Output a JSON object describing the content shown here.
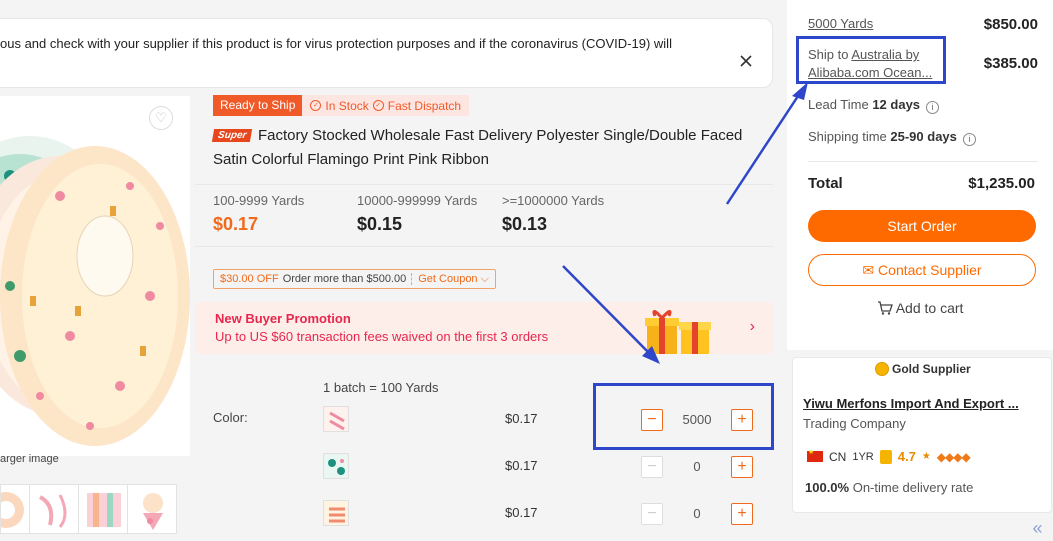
{
  "notice": {
    "text": "ous and check with your supplier if this product is for virus protection purposes and if the coronavirus (COVID-19) will"
  },
  "gallery": {
    "larger_hint": "arger image"
  },
  "product": {
    "badge_ready": "Ready to Ship",
    "badge_in_stock": "In Stock",
    "badge_fast_dispatch": "Fast Dispatch",
    "super_badge": "Super",
    "title": "Factory Stocked Wholesale Fast Delivery Polyester Single/Double Faced Satin Colorful Flamingo Print Pink Ribbon"
  },
  "price_tiers": [
    {
      "range": "100-9999 Yards",
      "price": "$0.17"
    },
    {
      "range": "10000-999999 Yards",
      "price": "$0.15"
    },
    {
      "range": ">=1000000 Yards",
      "price": "$0.13"
    }
  ],
  "coupon": {
    "off": "$30.00 OFF",
    "condition": "Order more than $500.00",
    "get": "Get Coupon"
  },
  "promo": {
    "title": "New Buyer Promotion",
    "subtitle": "Up to US $60 transaction fees waived on the first 3 orders"
  },
  "order": {
    "batch_note": "1 batch = 100 Yards",
    "color_label": "Color:",
    "variants": [
      {
        "price": "$0.17",
        "qty": "5000"
      },
      {
        "price": "$0.17",
        "qty": "0"
      },
      {
        "price": "$0.17",
        "qty": "0"
      }
    ]
  },
  "summary": {
    "qty_label": "5000 Yards",
    "qty_value": "$850.00",
    "ship_prefix": "Ship to ",
    "ship_dest": "Australia by",
    "ship_method": "Alibaba.com Ocean...",
    "ship_value": "$385.00",
    "lead_label": "Lead Time ",
    "lead_value": "12 days",
    "shipping_label": "Shipping time ",
    "shipping_value": "25-90 days",
    "total_label": "Total",
    "total_value": "$1,235.00",
    "start_order": "Start Order",
    "contact_supplier": "Contact Supplier",
    "add_to_cart": "Add to cart"
  },
  "supplier": {
    "tag": "Gold Supplier",
    "name": "Yiwu Merfons Import And Export ...",
    "type": "Trading Company",
    "country": "CN",
    "years": "1YR",
    "rating": "4.7",
    "delivery_rate": "100.0%",
    "delivery_label": " On-time delivery rate"
  },
  "colors": {
    "accent": "#ff6a00",
    "highlight": "#2e46c9",
    "promo_text": "#e8274d"
  }
}
